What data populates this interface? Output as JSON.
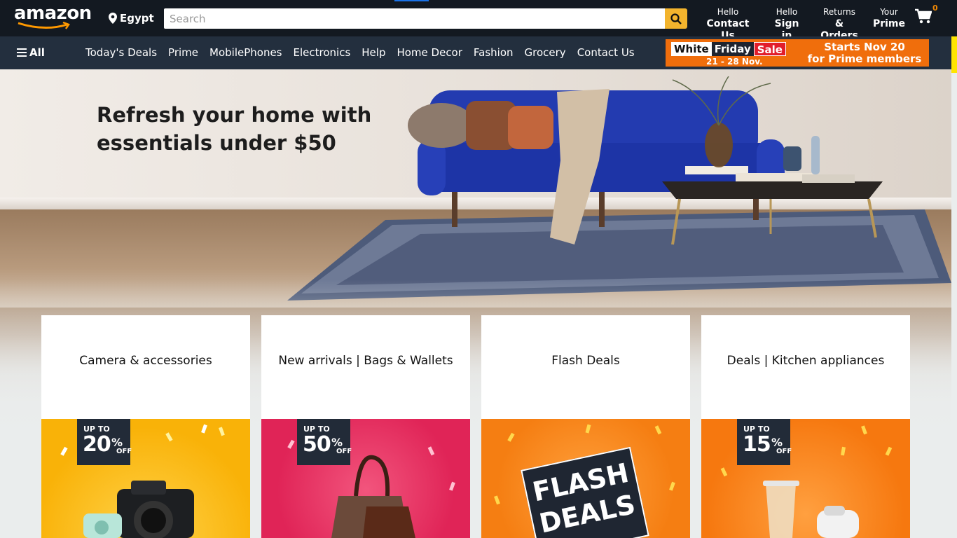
{
  "header": {
    "logo_text": "amazon",
    "location": "Egypt",
    "search_placeholder": "Search",
    "links": [
      {
        "line1": "Hello",
        "line2": "Contact Us"
      },
      {
        "line1": "Hello",
        "line2": "Sign in"
      },
      {
        "line1": "Returns",
        "line2": "& Orders"
      },
      {
        "line1": "Your",
        "line2": "Prime"
      }
    ],
    "cart_count": "0"
  },
  "subnav": {
    "all_label": "All",
    "items": [
      "Today's Deals",
      "Prime",
      "MobilePhones",
      "Electronics",
      "Help",
      "Home Decor",
      "Fashion",
      "Grocery",
      "Contact Us"
    ],
    "promo": {
      "white": "White",
      "friday": "Friday",
      "sale": "Sale",
      "dates": "21 - 28 Nov.",
      "starts_line1": "Starts Nov 20",
      "starts_line2": "for Prime members"
    }
  },
  "hero": {
    "headline_line1": "Refresh your home with",
    "headline_line2": "essentials under $50"
  },
  "cards": [
    {
      "title": "Camera & accessories",
      "badge_up": "UP TO",
      "badge_pct": "20",
      "badge_off": "OFF"
    },
    {
      "title": "New arrivals | Bags & Wallets",
      "badge_up": "UP TO",
      "badge_pct": "50",
      "badge_off": "OFF"
    },
    {
      "title": "Flash Deals",
      "flash_line1": "FLASH",
      "flash_line2": "DEALS"
    },
    {
      "title": "Deals | Kitchen appliances",
      "badge_up": "UP TO",
      "badge_pct": "15",
      "badge_off": "OFF"
    }
  ],
  "colors": {
    "topbar": "#131921",
    "subnav": "#232f3e",
    "search_button": "#f3b42d",
    "promo": "#f06e0c",
    "card1_bg": "#f9b208",
    "card2_bg": "#e72a5a",
    "card3_bg": "#f57e12",
    "card4_bg": "#f6780f"
  }
}
